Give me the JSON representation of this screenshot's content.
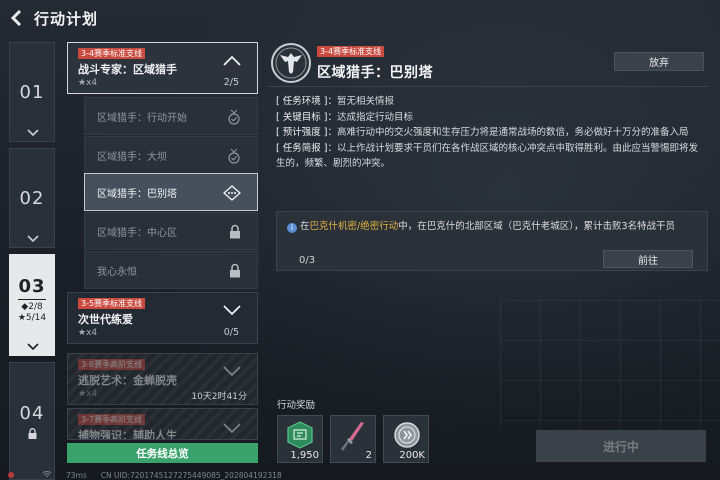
{
  "header": {
    "title": "行动计划"
  },
  "chapters": [
    {
      "num": "01"
    },
    {
      "num": "02"
    },
    {
      "num": "03",
      "stat1": "◆2/8",
      "stat2": "★5/14"
    },
    {
      "num": "04"
    }
  ],
  "missions": {
    "m1": {
      "tag": "3-4赛季标准支线",
      "title": "战斗专家：区域猎手",
      "stars": "★x4",
      "progress": "2/5"
    },
    "subs": [
      "区域猎手：行动开始",
      "区域猎手：大坝",
      "区域猎手：巴别塔",
      "区域猎手：中心区",
      "我心永恒"
    ],
    "m2": {
      "tag": "3-5赛季标准支线",
      "title": "次世代练爱",
      "stars": "★x4",
      "progress": "0/5"
    },
    "m3": {
      "tag": "3-8赛季高阶支线",
      "title": "逃脱艺术：金蝉脱壳",
      "stars": "★x4",
      "time": "10天2时41分"
    },
    "m4": {
      "tag": "3-7赛季高阶支线",
      "title": "捕物强识：辅助人生"
    }
  },
  "overview_button": "任务线总览",
  "detail": {
    "tag": "3-4赛季标准支线",
    "title": "区域猎手：巴别塔",
    "abandon": "放弃",
    "env_key": "[ 任务环境 ]：",
    "env_val": "暂无相关情报",
    "goal_key": "[ 关键目标 ]：",
    "goal_val": "达成指定行动目标",
    "strength_key": "[ 预计强度 ]：",
    "strength_val": "高难行动中的交火强度和生存压力将是通常战场的数倍，务必做好十万分的准备入局",
    "brief_key": "[ 任务简报 ]：",
    "brief_val": "以上作战计划要求干员们在各作战区域的核心冲突点中取得胜利。由此应当警惕即将发生的，频繁、剧烈的冲突。"
  },
  "task": {
    "pre": "在",
    "highlight": "巴克什机密/绝密行动",
    "post": "中，在巴克什的北部区域（巴克什老城区），累计击败3名特战干员",
    "count": "0/3",
    "goto": "前往"
  },
  "rewards": {
    "label": "行动奖励",
    "items": [
      {
        "icon": "green-token-icon",
        "qty": "1,950"
      },
      {
        "icon": "dagger-icon",
        "qty": "2"
      },
      {
        "icon": "silver-coin-icon",
        "qty": "200K"
      }
    ]
  },
  "progress_button": "进行中",
  "status": {
    "ping": "73ms",
    "uid": "CN UID:7201745127275449085_202804192318"
  },
  "colors": {
    "tag_red": "#c94a3f",
    "overview_green": "#3aa36b",
    "highlight_gold": "#e2b143"
  }
}
